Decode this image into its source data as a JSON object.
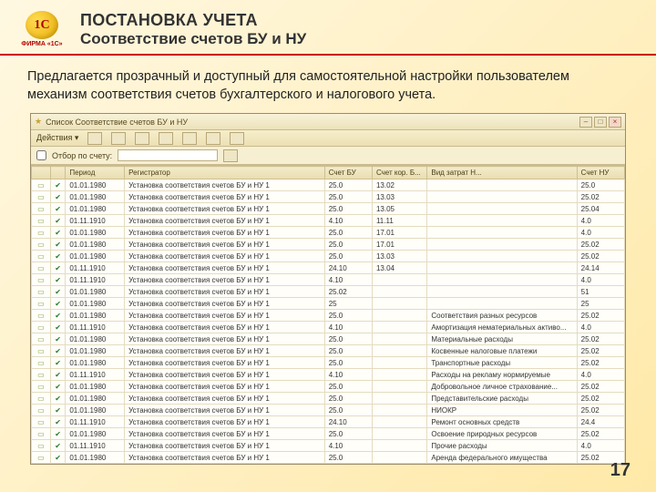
{
  "logo": {
    "mark": "1C",
    "caption": "ФИРМА «1С»"
  },
  "header": {
    "line1": "ПОСТАНОВКА УЧЕТА",
    "line2": "Соответствие счетов БУ и НУ"
  },
  "intro": "Предлагается прозрачный и доступный для самостоятельной настройки пользователем механизм соответствия счетов бухгалтерского и налогового учета.",
  "window": {
    "title": "Список Соответствие счетов БУ и НУ",
    "menu": [
      "Действия ▾"
    ],
    "filter_label": "Отбор по счету:",
    "columns": [
      "",
      "",
      "Период",
      "Регистратор",
      "Счет БУ",
      "Счет кор. Б...",
      "Вид затрат Н...",
      "Счет НУ"
    ]
  },
  "rows": [
    {
      "period": "01.01.1980",
      "reg": "Установка соответствия счетов БУ и НУ 1",
      "c1": "25.0",
      "c2": "13.02",
      "c3": "",
      "c4": "25.0"
    },
    {
      "period": "01.01.1980",
      "reg": "Установка соответствия счетов БУ и НУ 1",
      "c1": "25.0",
      "c2": "13.03",
      "c3": "",
      "c4": "25.02"
    },
    {
      "period": "01.01.1980",
      "reg": "Установка соответствия счетов БУ и НУ 1",
      "c1": "25.0",
      "c2": "13.05",
      "c3": "",
      "c4": "25.04"
    },
    {
      "period": "01.11.1910",
      "reg": "Установка соответствия счетов БУ и НУ 1",
      "c1": "4.10",
      "c2": "11.11",
      "c3": "",
      "c4": "4.0"
    },
    {
      "period": "01.01.1980",
      "reg": "Установка соответствия счетов БУ и НУ 1",
      "c1": "25.0",
      "c2": "17.01",
      "c3": "",
      "c4": "4.0"
    },
    {
      "period": "01.01.1980",
      "reg": "Установка соответствия счетов БУ и НУ 1",
      "c1": "25.0",
      "c2": "17.01",
      "c3": "",
      "c4": "25.02"
    },
    {
      "period": "01.01.1980",
      "reg": "Установка соответствия счетов БУ и НУ 1",
      "c1": "25.0",
      "c2": "13.03",
      "c3": "",
      "c4": "25.02"
    },
    {
      "period": "01.11.1910",
      "reg": "Установка соответствия счетов БУ и НУ 1",
      "c1": "24.10",
      "c2": "13.04",
      "c3": "",
      "c4": "24.14"
    },
    {
      "period": "01.11.1910",
      "reg": "Установка соответствия счетов БУ и НУ 1",
      "c1": "4.10",
      "c2": "",
      "c3": "",
      "c4": "4.0"
    },
    {
      "period": "01.01.1980",
      "reg": "Установка соответствия счетов БУ и НУ 1",
      "c1": "25.02",
      "c2": "",
      "c3": "",
      "c4": "51"
    },
    {
      "period": "01.01.1980",
      "reg": "Установка соответствия счетов БУ и НУ 1",
      "c1": "25",
      "c2": "",
      "c3": "",
      "c4": "25"
    },
    {
      "period": "01.01.1980",
      "reg": "Установка соответствия счетов БУ и НУ 1",
      "c1": "25.0",
      "c2": "",
      "c3": "Соответствия разных ресурсов",
      "c4": "25.02"
    },
    {
      "period": "01.11.1910",
      "reg": "Установка соответствия счетов БУ и НУ 1",
      "c1": "4.10",
      "c2": "",
      "c3": "Амортизация нематериальных активо...",
      "c4": "4.0"
    },
    {
      "period": "01.01.1980",
      "reg": "Установка соответствия счетов БУ и НУ 1",
      "c1": "25.0",
      "c2": "",
      "c3": "Материальные расходы",
      "c4": "25.02"
    },
    {
      "period": "01.01.1980",
      "reg": "Установка соответствия счетов БУ и НУ 1",
      "c1": "25.0",
      "c2": "",
      "c3": "Косвенные налоговые платежи",
      "c4": "25.02"
    },
    {
      "period": "01.01.1980",
      "reg": "Установка соответствия счетов БУ и НУ 1",
      "c1": "25.0",
      "c2": "",
      "c3": "Транспортные расходы",
      "c4": "25.02"
    },
    {
      "period": "01.11.1910",
      "reg": "Установка соответствия счетов БУ и НУ 1",
      "c1": "4.10",
      "c2": "",
      "c3": "Расходы на рекламу нормируемые",
      "c4": "4.0"
    },
    {
      "period": "01.01.1980",
      "reg": "Установка соответствия счетов БУ и НУ 1",
      "c1": "25.0",
      "c2": "",
      "c3": "Добровольное личное страхование...",
      "c4": "25.02"
    },
    {
      "period": "01.01.1980",
      "reg": "Установка соответствия счетов БУ и НУ 1",
      "c1": "25.0",
      "c2": "",
      "c3": "Представительские расходы",
      "c4": "25.02"
    },
    {
      "period": "01.01.1980",
      "reg": "Установка соответствия счетов БУ и НУ 1",
      "c1": "25.0",
      "c2": "",
      "c3": "НИОКР",
      "c4": "25.02"
    },
    {
      "period": "01.11.1910",
      "reg": "Установка соответствия счетов БУ и НУ 1",
      "c1": "24.10",
      "c2": "",
      "c3": "Ремонт основных средств",
      "c4": "24.4"
    },
    {
      "period": "01.01.1980",
      "reg": "Установка соответствия счетов БУ и НУ 1",
      "c1": "25.0",
      "c2": "",
      "c3": "Освоение природных ресурсов",
      "c4": "25.02"
    },
    {
      "period": "01.11.1910",
      "reg": "Установка соответствия счетов БУ и НУ 1",
      "c1": "4.10",
      "c2": "",
      "c3": "Прочие расходы",
      "c4": "4.0"
    },
    {
      "period": "01.01.1980",
      "reg": "Установка соответствия счетов БУ и НУ 1",
      "c1": "25.0",
      "c2": "",
      "c3": "Аренда федерального имущества",
      "c4": "25.02"
    }
  ],
  "page": "17"
}
